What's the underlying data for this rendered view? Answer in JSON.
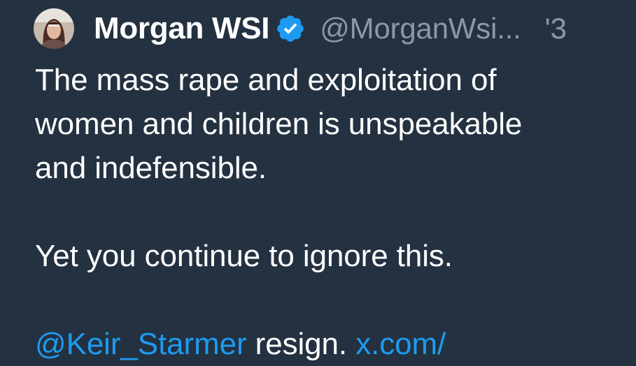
{
  "tweet": {
    "display_name": "Morgan WSI",
    "handle": "@MorganWsi...",
    "timestamp": "'3",
    "verified_icon": "verified-badge-icon",
    "body": {
      "line1": "The mass rape and exploitation of",
      "line2": "women and children is unspeakable",
      "line3": "and indefensible.",
      "line4": "Yet you continue to ignore this.",
      "mention": "@Keir_Starmer",
      "after_mention": " resign. ",
      "link": "x.com/"
    }
  },
  "colors": {
    "background": "#243140",
    "text": "#ffffff",
    "secondary": "#8b98a5",
    "accent": "#1d9bf0"
  }
}
